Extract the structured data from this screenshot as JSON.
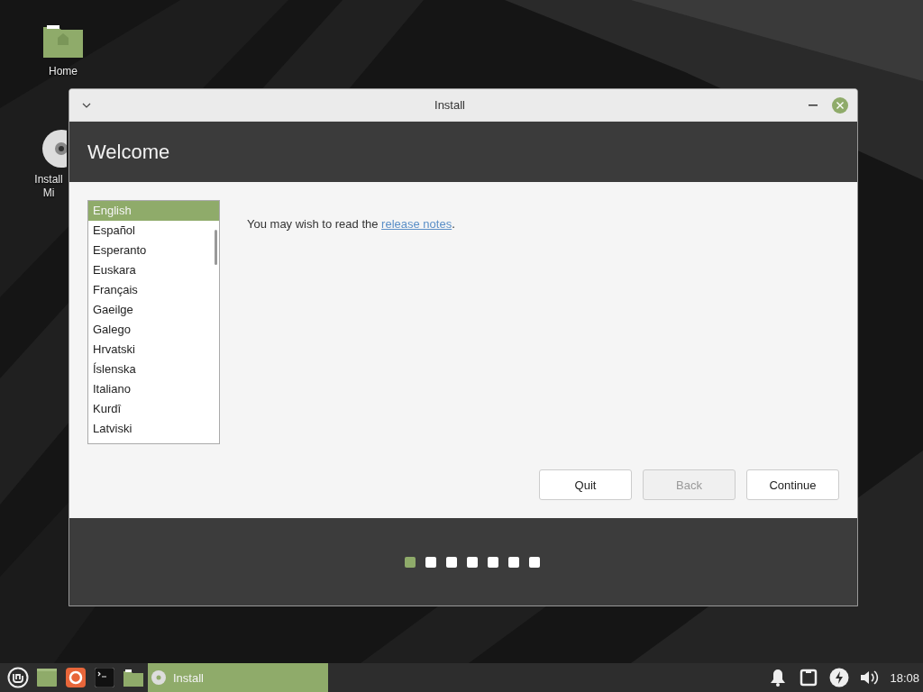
{
  "desktop_icons": [
    {
      "kind": "folder",
      "label_lines": [
        "Home"
      ]
    },
    {
      "kind": "disc",
      "label_lines": [
        "Install",
        "Mi"
      ]
    }
  ],
  "window": {
    "title": "Install",
    "header": "Welcome",
    "languages": [
      {
        "name": "English",
        "selected": true
      },
      {
        "name": "Español",
        "selected": false
      },
      {
        "name": "Esperanto",
        "selected": false
      },
      {
        "name": "Euskara",
        "selected": false
      },
      {
        "name": "Français",
        "selected": false
      },
      {
        "name": "Gaeilge",
        "selected": false
      },
      {
        "name": "Galego",
        "selected": false
      },
      {
        "name": "Hrvatski",
        "selected": false
      },
      {
        "name": "Íslenska",
        "selected": false
      },
      {
        "name": "Italiano",
        "selected": false
      },
      {
        "name": "Kurdî",
        "selected": false
      },
      {
        "name": "Latviski",
        "selected": false
      }
    ],
    "message": {
      "text": "You may wish to read the ",
      "link": "release notes",
      "after": "."
    },
    "buttons": [
      {
        "label": "Quit",
        "disabled": false
      },
      {
        "label": "Back",
        "disabled": true
      },
      {
        "label": "Continue",
        "disabled": false
      }
    ],
    "steps": [
      {
        "selected": true
      },
      {
        "selected": false
      },
      {
        "selected": false
      },
      {
        "selected": false
      },
      {
        "selected": false
      },
      {
        "selected": false
      },
      {
        "selected": false
      }
    ]
  },
  "taskbar": {
    "launchers": [
      {
        "kind": "menu"
      },
      {
        "kind": "desktop"
      },
      {
        "kind": "browser"
      },
      {
        "kind": "terminal"
      },
      {
        "kind": "files"
      }
    ],
    "tasks": [
      {
        "label": "Install",
        "selected": true
      }
    ],
    "tray": [
      {
        "kind": "bell"
      },
      {
        "kind": "network"
      },
      {
        "kind": "power"
      },
      {
        "kind": "volume"
      }
    ],
    "clock": "18:08"
  }
}
